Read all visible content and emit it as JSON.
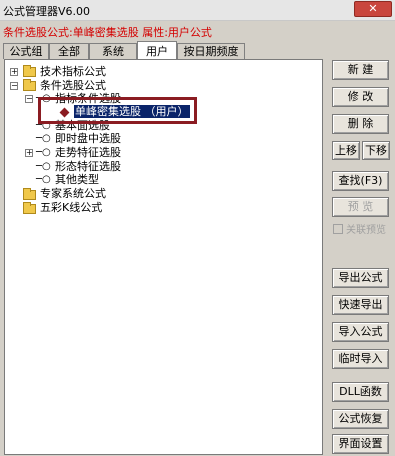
{
  "window": {
    "title": "公式管理器V6.00",
    "close": "✕"
  },
  "subtitle": "条件选股公式:单峰密集选股 属性:用户公式",
  "tabs": [
    "公式组",
    "全部",
    "系统",
    "用户",
    "按日期频度"
  ],
  "tree": {
    "tech": "技术指标公式",
    "cond": "条件选股公式",
    "indicator": "指标条件选股",
    "selected": "单峰密集选股 （用户）",
    "fundamental": "基本面选股",
    "realtime": "即时盘中选股",
    "trend": "走势特征选股",
    "shape": "形态特征选股",
    "other": "其他类型",
    "expert": "专家系统公式",
    "colorful": "五彩K线公式"
  },
  "buttons": {
    "new": "新  建",
    "modify": "修  改",
    "delete": "删  除",
    "up": "上移",
    "down": "下移",
    "find": "查找(F3)",
    "preview": "预  览",
    "link_preview": "关联预览",
    "export": "导出公式",
    "quick_export": "快速导出",
    "import": "导入公式",
    "temp_import": "临时导入",
    "dll": "DLL函数",
    "restore": "公式恢复",
    "ui_settings": "界面设置"
  }
}
